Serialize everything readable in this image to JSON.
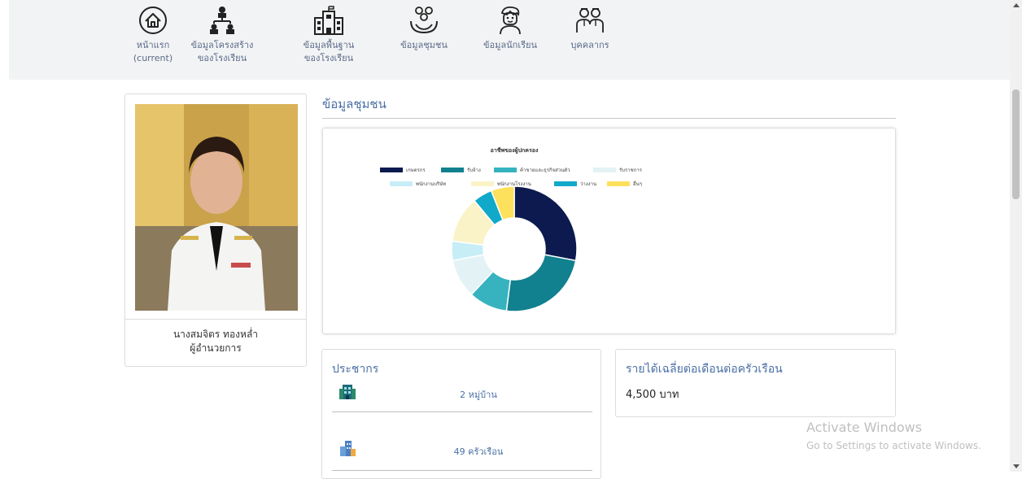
{
  "nav": {
    "items": [
      {
        "label": "หน้าแรก",
        "label2": "(current)",
        "icon": "home-icon"
      },
      {
        "label": "ข้อมูลโครงสร้าง",
        "label2": "ของโรงเรียน",
        "icon": "org-chart-icon"
      },
      {
        "label": "ข้อมูลพื้นฐาน",
        "label2": "ของโรงเรียน",
        "icon": "school-building-icon"
      },
      {
        "label": "ข้อมูลชุมชน",
        "label2": "",
        "icon": "community-icon"
      },
      {
        "label": "ข้อมูลนักเรียน",
        "label2": "",
        "icon": "student-icon"
      },
      {
        "label": "บุคคลากร",
        "label2": "",
        "icon": "personnel-icon"
      }
    ]
  },
  "director": {
    "name": "นางสมจิตร ทองหล่ำ",
    "position": "ผู้อำนวยการ"
  },
  "section": {
    "title": "ข้อมูลชุมชน"
  },
  "chart_data": {
    "type": "pie",
    "title": "อาชีพของผู้ปกครอง",
    "legend_position": "top",
    "categories": [
      "เกษตรกร",
      "รับจ้าง",
      "ค้าขายและธุรกิจส่วนตัว",
      "รับราชการ",
      "พนักงานบริษัท",
      "พนักงานโรงงาน",
      "ว่างงาน",
      "อื่นๆ"
    ],
    "values": [
      28,
      24,
      10,
      10,
      5,
      12,
      5,
      6
    ],
    "colors": [
      "#0c1a4f",
      "#11808f",
      "#37b3c0",
      "#e3f2f5",
      "#c7eef7",
      "#fbf3c8",
      "#11a9c9",
      "#fde05c"
    ]
  },
  "population": {
    "heading": "ประชากร",
    "rows": [
      {
        "value": "2 หมู่บ้าน",
        "icon": "building-icon"
      },
      {
        "value": "49 ครัวเรือน",
        "icon": "apartments-icon"
      }
    ]
  },
  "income": {
    "heading": "รายได้เฉลี่ยต่อเดือนต่อครัวเรือน",
    "value": "4,500 บาท"
  },
  "watermark": {
    "line1": "Activate Windows",
    "line2": "Go to Settings to activate Windows."
  }
}
